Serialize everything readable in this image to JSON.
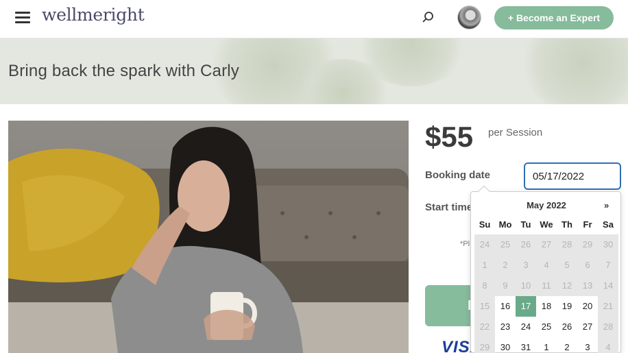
{
  "header": {
    "logo": "wellmeright",
    "expert_button": "+ Become an Expert"
  },
  "banner": {
    "title": "Bring back the spark with Carly"
  },
  "pricing": {
    "price": "$55",
    "unit": "per Session",
    "booking_label": "Booking date",
    "booking_value": "05/17/2022",
    "start_label": "Start time",
    "note": "*Pl",
    "book_button": "B",
    "payment_logo": "VISA"
  },
  "datepicker": {
    "month": "May 2022",
    "next": "»",
    "weekdays": [
      "Su",
      "Mo",
      "Tu",
      "We",
      "Th",
      "Fr",
      "Sa"
    ],
    "weeks": [
      [
        {
          "d": "24",
          "s": "disabled"
        },
        {
          "d": "25",
          "s": "disabled"
        },
        {
          "d": "26",
          "s": "disabled"
        },
        {
          "d": "27",
          "s": "disabled"
        },
        {
          "d": "28",
          "s": "disabled"
        },
        {
          "d": "29",
          "s": "disabled"
        },
        {
          "d": "30",
          "s": "disabled"
        }
      ],
      [
        {
          "d": "1",
          "s": "disabled"
        },
        {
          "d": "2",
          "s": "disabled"
        },
        {
          "d": "3",
          "s": "disabled"
        },
        {
          "d": "4",
          "s": "disabled"
        },
        {
          "d": "5",
          "s": "disabled"
        },
        {
          "d": "6",
          "s": "disabled"
        },
        {
          "d": "7",
          "s": "disabled"
        }
      ],
      [
        {
          "d": "8",
          "s": "disabled"
        },
        {
          "d": "9",
          "s": "disabled"
        },
        {
          "d": "10",
          "s": "disabled"
        },
        {
          "d": "11",
          "s": "disabled"
        },
        {
          "d": "12",
          "s": "disabled"
        },
        {
          "d": "13",
          "s": "disabled"
        },
        {
          "d": "14",
          "s": "disabled"
        }
      ],
      [
        {
          "d": "15",
          "s": "disabled"
        },
        {
          "d": "16",
          "s": "enabled"
        },
        {
          "d": "17",
          "s": "active"
        },
        {
          "d": "18",
          "s": "enabled"
        },
        {
          "d": "19",
          "s": "enabled"
        },
        {
          "d": "20",
          "s": "enabled"
        },
        {
          "d": "21",
          "s": "disabled"
        }
      ],
      [
        {
          "d": "22",
          "s": "disabled"
        },
        {
          "d": "23",
          "s": "enabled"
        },
        {
          "d": "24",
          "s": "enabled"
        },
        {
          "d": "25",
          "s": "enabled"
        },
        {
          "d": "26",
          "s": "enabled"
        },
        {
          "d": "27",
          "s": "enabled"
        },
        {
          "d": "28",
          "s": "disabled"
        }
      ],
      [
        {
          "d": "29",
          "s": "disabled"
        },
        {
          "d": "30",
          "s": "enabled"
        },
        {
          "d": "31",
          "s": "enabled"
        },
        {
          "d": "1",
          "s": "enabled"
        },
        {
          "d": "2",
          "s": "enabled"
        },
        {
          "d": "3",
          "s": "enabled"
        },
        {
          "d": "4",
          "s": "disabled"
        }
      ]
    ]
  },
  "colors": {
    "accent_green": "#86bb9b",
    "selected_day": "#6aaa8a",
    "input_focus": "#2e6fb3"
  }
}
